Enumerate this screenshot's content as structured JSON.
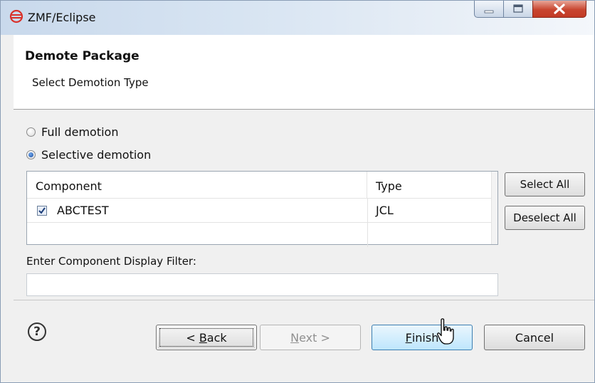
{
  "window": {
    "title": "ZMF/Eclipse"
  },
  "header": {
    "title": "Demote Package",
    "subtitle": "Select Demotion Type"
  },
  "options": {
    "full_label": "Full demotion",
    "selective_label": "Selective demotion",
    "selected": "selective"
  },
  "table": {
    "columns": [
      "Component",
      "Type"
    ],
    "rows": [
      {
        "name": "ABCTEST",
        "type": "JCL",
        "checked": true
      }
    ]
  },
  "side_buttons": {
    "select_all": "Select All",
    "deselect_all": "Deselect All"
  },
  "filter": {
    "label": "Enter Component Display Filter:",
    "value": ""
  },
  "footer": {
    "help": "?",
    "back": {
      "prefix": "< ",
      "mnemonic": "B",
      "rest": "ack"
    },
    "next": {
      "mnemonic": "N",
      "rest": "ext >"
    },
    "finish": {
      "mnemonic": "F",
      "rest": "inish"
    },
    "cancel": "Cancel"
  },
  "colors": {
    "accent": "#3c7fb1",
    "close": "#c8452f",
    "app_icon": "#d9322b"
  }
}
